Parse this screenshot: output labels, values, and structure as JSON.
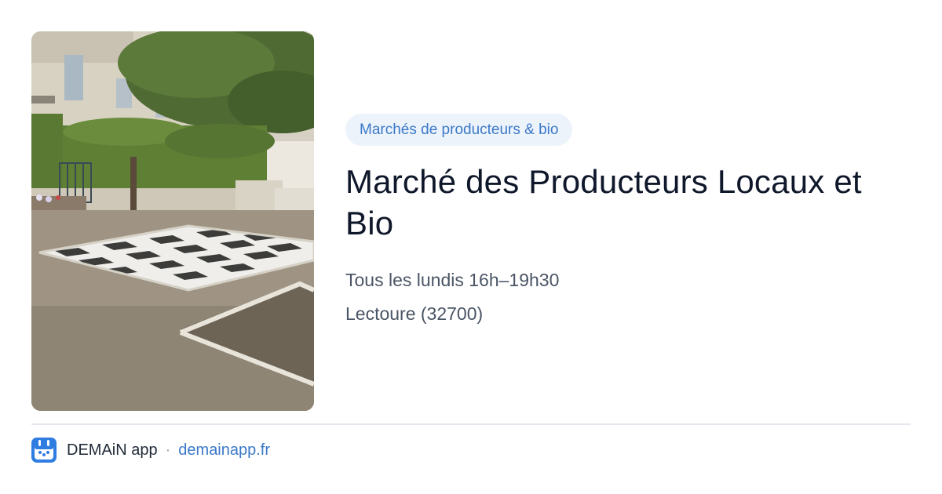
{
  "card": {
    "category": "Marchés de producteurs & bio",
    "title": "Marché des Producteurs Locaux et Bio",
    "schedule": "Tous les lundis 16h–19h30",
    "location": "Lectoure (32700)"
  },
  "photo": {
    "description_icon": "market-square-photo"
  },
  "footer": {
    "app_name": "DEMAiN app",
    "separator": "·",
    "domain": "demainapp.fr"
  },
  "colors": {
    "accent": "#3b79c9",
    "tag_background": "#edf3fb",
    "title": "#0f172a",
    "meta": "#4a5565",
    "divider": "#e3e8ee"
  }
}
